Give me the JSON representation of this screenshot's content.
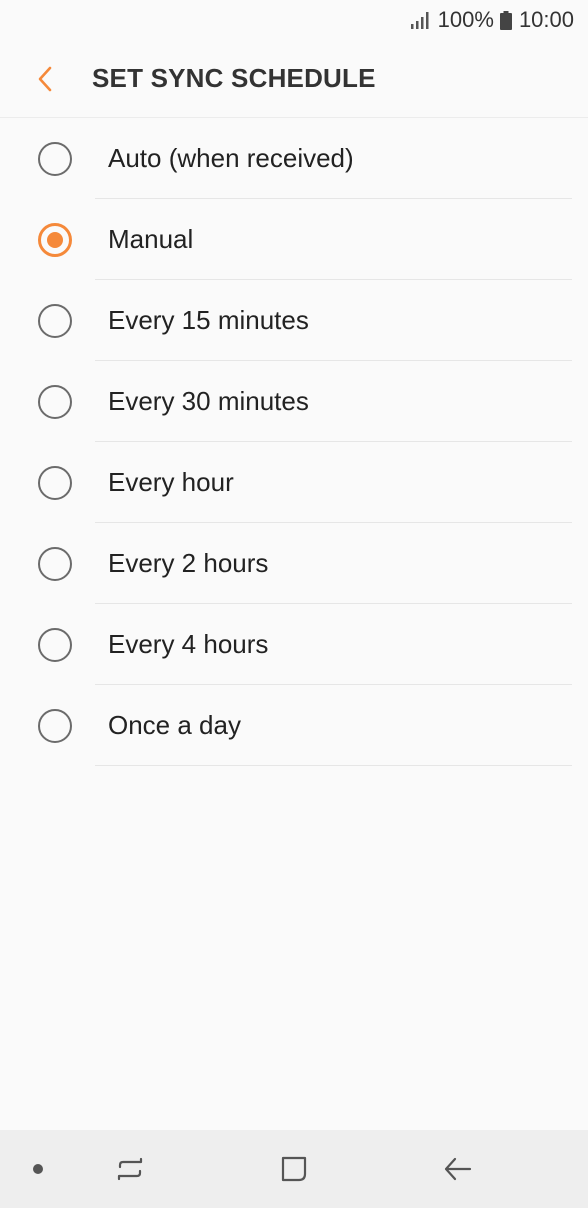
{
  "status_bar": {
    "battery_percent": "100%",
    "time": "10:00",
    "icons": [
      "signal-icon",
      "battery-icon"
    ]
  },
  "header": {
    "back_icon": "chevron-left-icon",
    "title": "SET SYNC SCHEDULE"
  },
  "options": [
    {
      "label": "Auto (when received)",
      "selected": false
    },
    {
      "label": "Manual",
      "selected": true
    },
    {
      "label": "Every 15 minutes",
      "selected": false
    },
    {
      "label": "Every 30 minutes",
      "selected": false
    },
    {
      "label": "Every hour",
      "selected": false
    },
    {
      "label": "Every 2 hours",
      "selected": false
    },
    {
      "label": "Every 4 hours",
      "selected": false
    },
    {
      "label": "Once a day",
      "selected": false
    }
  ],
  "nav_bar": {
    "icons": [
      "nav-dot-icon",
      "recents-icon",
      "home-icon",
      "back-arrow-icon"
    ]
  },
  "colors": {
    "accent": "#f5893a",
    "background": "#fafafa",
    "nav_background": "#eeeeee"
  }
}
